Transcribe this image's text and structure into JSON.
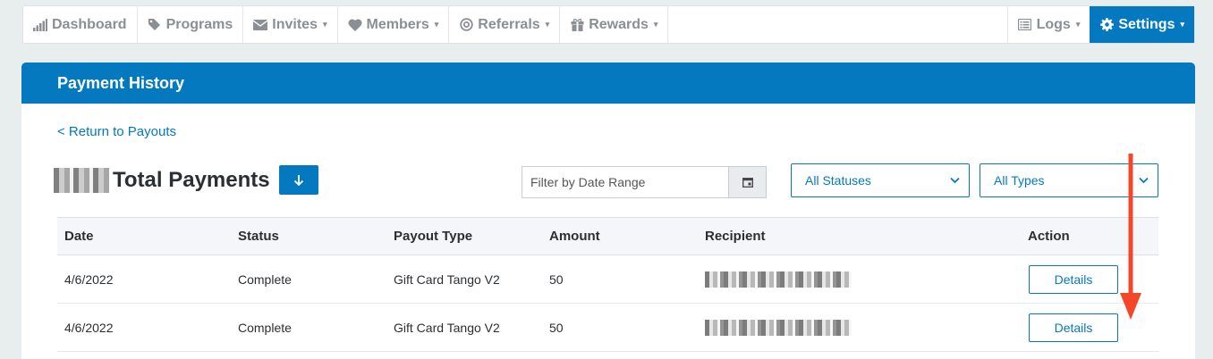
{
  "nav": {
    "dashboard": "Dashboard",
    "programs": "Programs",
    "invites": "Invites",
    "members": "Members",
    "referrals": "Referrals",
    "rewards": "Rewards",
    "logs": "Logs",
    "settings": "Settings"
  },
  "panel": {
    "title": "Payment History",
    "return_link": "< Return to Payouts",
    "total_label": "Total Payments"
  },
  "filters": {
    "date_placeholder": "Filter by Date Range",
    "status_selected": "All Statuses",
    "type_selected": "All Types"
  },
  "table": {
    "headers": [
      "Date",
      "Status",
      "Payout Type",
      "Amount",
      "Recipient",
      "Action"
    ],
    "rows": [
      {
        "date": "4/6/2022",
        "status": "Complete",
        "type": "Gift Card Tango V2",
        "amount": "50",
        "action": "Details"
      },
      {
        "date": "4/6/2022",
        "status": "Complete",
        "type": "Gift Card Tango V2",
        "amount": "50",
        "action": "Details"
      }
    ]
  },
  "colors": {
    "accent": "#0479c0",
    "annotation_arrow": "#f4472a"
  }
}
